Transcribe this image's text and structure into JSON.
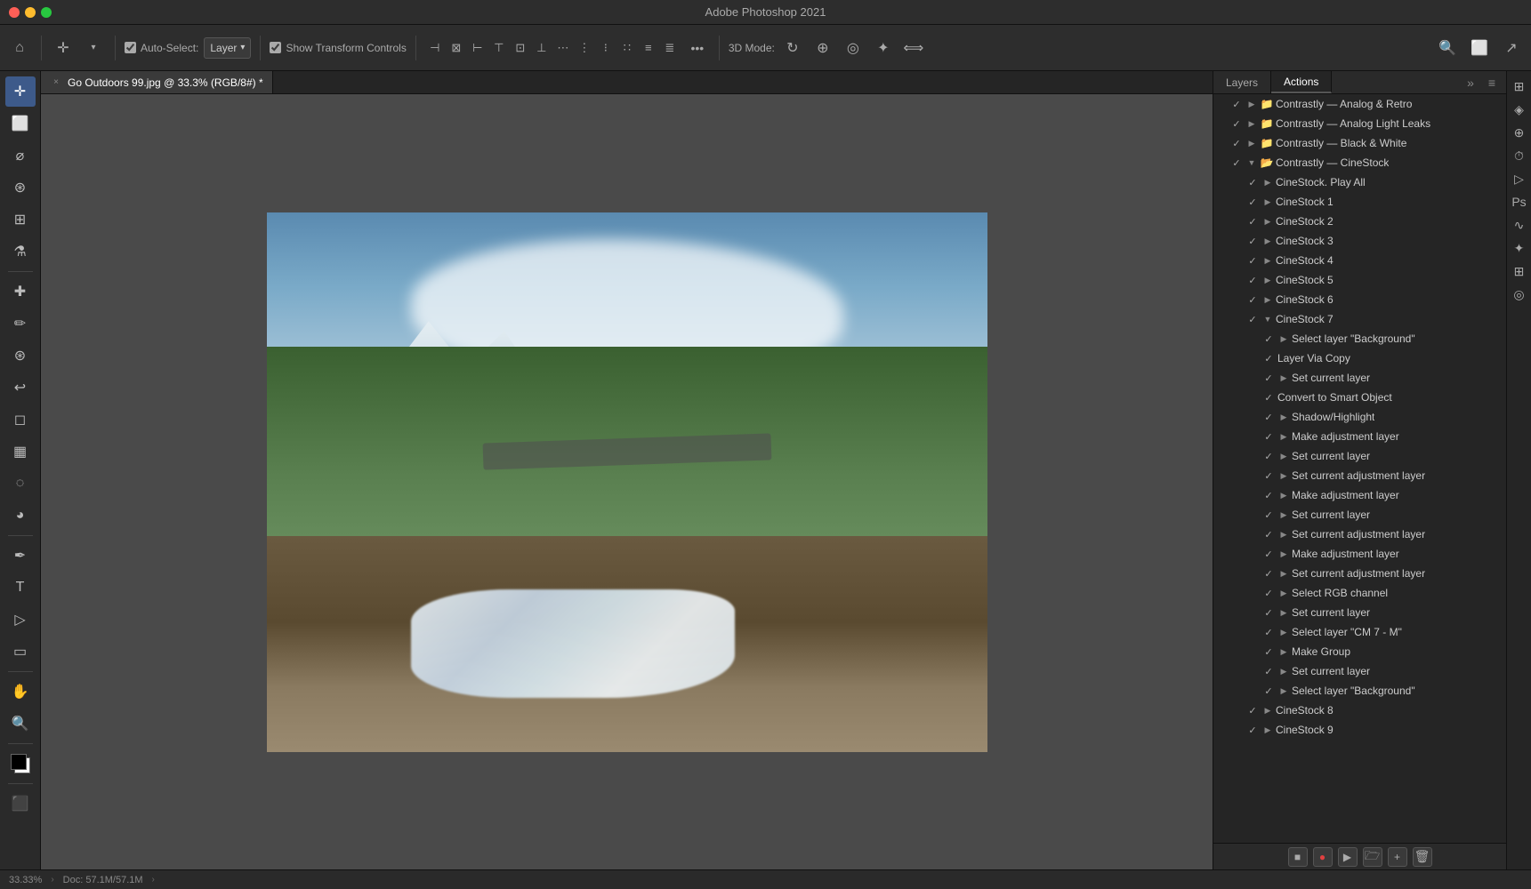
{
  "app": {
    "title": "Adobe Photoshop 2021",
    "window_controls": [
      "close",
      "minimize",
      "maximize"
    ]
  },
  "toolbar": {
    "auto_select_label": "Auto-Select:",
    "layer_dropdown": "Layer",
    "show_transform_controls": "Show Transform Controls",
    "three_d_mode": "3D Mode:",
    "more_icon": "•••"
  },
  "tab": {
    "title": "Go Outdoors 99.jpg @ 33.3% (RGB/8#) *",
    "close": "×"
  },
  "canvas": {
    "zoom": "33.33%",
    "doc_size": "Doc: 57.1M/57.1M"
  },
  "panel_tabs": {
    "layers": "Layers",
    "actions": "Actions"
  },
  "actions": {
    "groups": [
      {
        "id": "contrastly-analog-retro",
        "checked": true,
        "expanded": false,
        "label": "Contrastly — Analog & Retro",
        "indent": "indent1",
        "folder": true
      },
      {
        "id": "contrastly-analog-light-leaks",
        "checked": true,
        "expanded": false,
        "label": "Contrastly — Analog Light Leaks",
        "indent": "indent1",
        "folder": true
      },
      {
        "id": "contrastly-black-white",
        "checked": true,
        "expanded": false,
        "label": "Contrastly — Black & White",
        "indent": "indent1",
        "folder": true
      },
      {
        "id": "contrastly-cinestock",
        "checked": true,
        "expanded": true,
        "label": "Contrastly — CineStock",
        "indent": "indent1",
        "folder": true
      }
    ],
    "cinestock_items": [
      {
        "id": "cinestock-play-all",
        "checked": true,
        "expanded": false,
        "label": "CineStock. Play All",
        "indent": "indent2",
        "folder": false
      },
      {
        "id": "cinestock-1",
        "checked": true,
        "expanded": false,
        "label": "CineStock 1",
        "indent": "indent2",
        "folder": false
      },
      {
        "id": "cinestock-2",
        "checked": true,
        "expanded": false,
        "label": "CineStock 2",
        "indent": "indent2",
        "folder": false
      },
      {
        "id": "cinestock-3",
        "checked": true,
        "expanded": false,
        "label": "CineStock 3",
        "indent": "indent2",
        "folder": false
      },
      {
        "id": "cinestock-4",
        "checked": true,
        "expanded": false,
        "label": "CineStock 4",
        "indent": "indent2",
        "folder": false
      },
      {
        "id": "cinestock-5",
        "checked": true,
        "expanded": false,
        "label": "CineStock 5",
        "indent": "indent2",
        "folder": false
      },
      {
        "id": "cinestock-6",
        "checked": true,
        "expanded": false,
        "label": "CineStock 6",
        "indent": "indent2",
        "folder": false
      },
      {
        "id": "cinestock-7",
        "checked": true,
        "expanded": true,
        "label": "CineStock 7",
        "indent": "indent2",
        "folder": false
      }
    ],
    "cinestock7_items": [
      {
        "id": "select-background",
        "checked": true,
        "label": "Select layer \"Background\"",
        "indent": "indent3"
      },
      {
        "id": "layer-via-copy",
        "checked": true,
        "label": "Layer Via Copy",
        "indent": "indent3"
      },
      {
        "id": "set-current-layer-1",
        "checked": true,
        "label": "Set current layer",
        "indent": "indent3"
      },
      {
        "id": "convert-smart-object",
        "checked": true,
        "label": "Convert to Smart Object",
        "indent": "indent3"
      },
      {
        "id": "shadow-highlight",
        "checked": true,
        "label": "Shadow/Highlight",
        "indent": "indent3"
      },
      {
        "id": "make-adjustment-layer-1",
        "checked": true,
        "label": "Make adjustment layer",
        "indent": "indent3"
      },
      {
        "id": "set-current-layer-2",
        "checked": true,
        "label": "Set current layer",
        "indent": "indent3"
      },
      {
        "id": "set-current-adj-1",
        "checked": true,
        "label": "Set current adjustment layer",
        "indent": "indent3"
      },
      {
        "id": "make-adjustment-layer-2",
        "checked": true,
        "label": "Make adjustment layer",
        "indent": "indent3"
      },
      {
        "id": "set-current-layer-3",
        "checked": true,
        "label": "Set current layer",
        "indent": "indent3"
      },
      {
        "id": "set-current-adj-2",
        "checked": true,
        "label": "Set current adjustment layer",
        "indent": "indent3"
      },
      {
        "id": "make-adjustment-layer-3",
        "checked": true,
        "label": "Make adjustment layer",
        "indent": "indent3"
      },
      {
        "id": "set-current-adj-3",
        "checked": true,
        "label": "Set current adjustment layer",
        "indent": "indent3"
      },
      {
        "id": "select-rgb-channel",
        "checked": true,
        "label": "Select RGB channel",
        "indent": "indent3"
      },
      {
        "id": "set-current-layer-4",
        "checked": true,
        "label": "Set current layer",
        "indent": "indent3"
      },
      {
        "id": "select-layer-cm7",
        "checked": true,
        "label": "Select layer \"CM 7 - M\"",
        "indent": "indent3"
      },
      {
        "id": "make-group",
        "checked": true,
        "label": "Make Group",
        "indent": "indent3"
      },
      {
        "id": "set-current-layer-5",
        "checked": true,
        "label": "Set current layer",
        "indent": "indent3"
      },
      {
        "id": "select-background-2",
        "checked": true,
        "label": "Select layer \"Background\"",
        "indent": "indent3"
      }
    ],
    "more_groups": [
      {
        "id": "cinestock-8",
        "checked": true,
        "expanded": false,
        "label": "CineStock 8",
        "indent": "indent2",
        "folder": false
      },
      {
        "id": "cinestock-9",
        "checked": true,
        "expanded": false,
        "label": "CineStock 9",
        "indent": "indent2",
        "folder": false
      }
    ]
  },
  "panel_footer": {
    "stop_btn": "■",
    "record_btn": "●",
    "play_btn": "▶",
    "folder_btn": "🗁",
    "new_btn": "+",
    "delete_btn": "🗑"
  },
  "right_strip_icons": [
    "▷",
    "◈",
    "⊕",
    "⏱",
    "✦",
    "✳",
    "☆",
    "⌘",
    "⊞"
  ],
  "status_bar": {
    "zoom": "33.33%",
    "doc_size": "Doc: 57.1M/57.1M",
    "arrow": "›"
  },
  "colors": {
    "bg_dark": "#1e1e1e",
    "bg_panel": "#252525",
    "bg_toolbar": "#2d2d2d",
    "accent_blue": "#3d5a8a",
    "text_primary": "#cccccc",
    "text_muted": "#888888",
    "check_color": "#aaaaaa"
  }
}
